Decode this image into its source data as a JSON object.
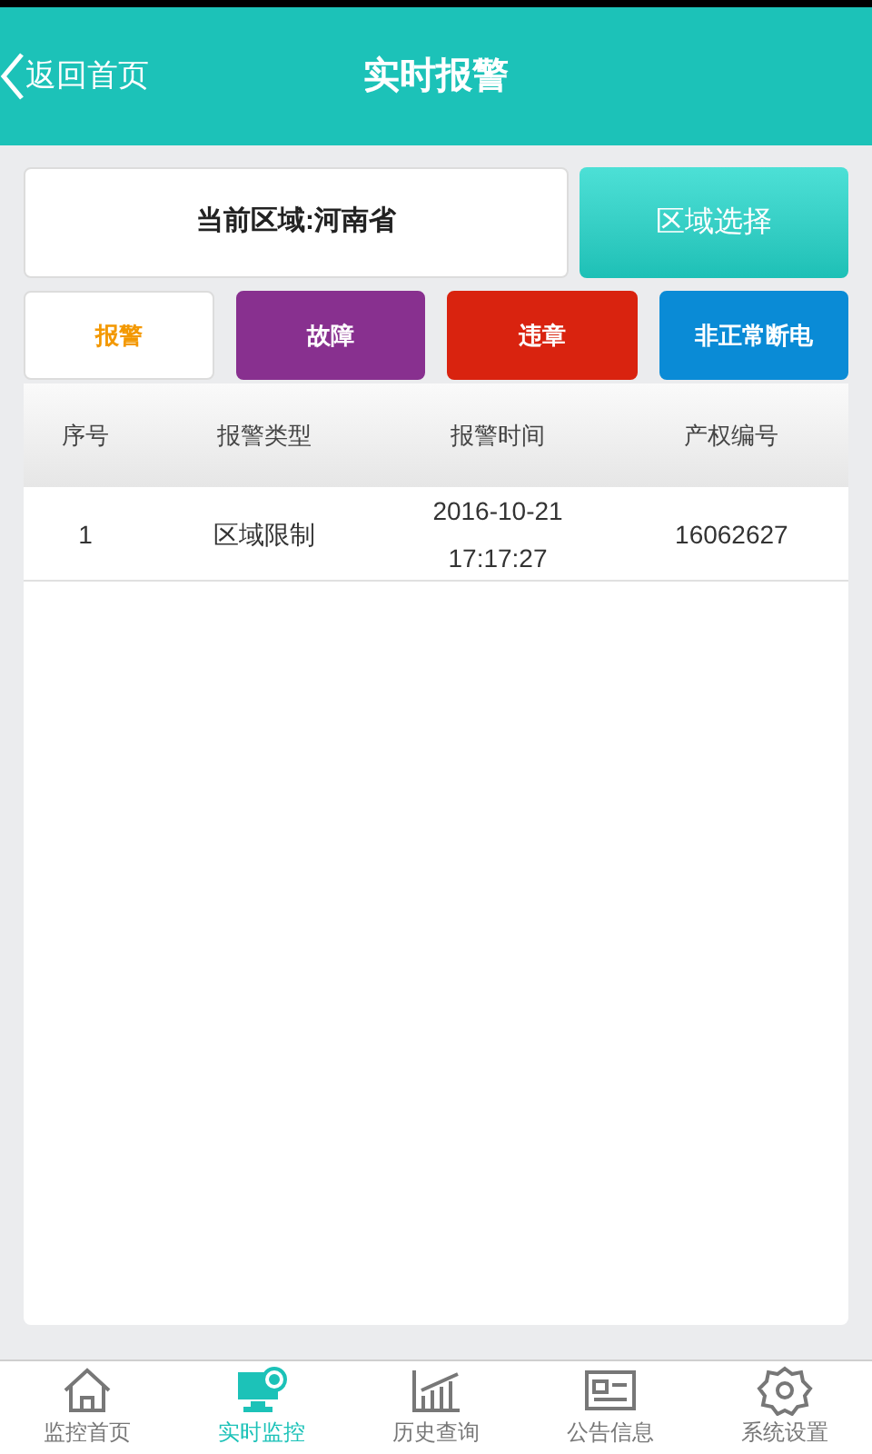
{
  "header": {
    "back": "返回首页",
    "title": "实时报警"
  },
  "region": {
    "label": "当前区域:河南省",
    "button": "区域选择"
  },
  "filters": [
    {
      "label": "报警",
      "color": "#f39800",
      "selected": true
    },
    {
      "label": "故障",
      "color": "#88308f",
      "selected": false
    },
    {
      "label": "违章",
      "color": "#d9230f",
      "selected": false
    },
    {
      "label": "非正常断电",
      "color": "#0a8bd6",
      "selected": false
    }
  ],
  "table": {
    "columns": [
      "序号",
      "报警类型",
      "报警时间",
      "产权编号"
    ],
    "rows": [
      [
        "1",
        "区域限制",
        "2016-10-21\n17:17:27",
        "16062627"
      ]
    ]
  },
  "nav": [
    {
      "kind": "home",
      "label": "监控首页",
      "selected": false
    },
    {
      "kind": "monitor",
      "label": "实时监控",
      "selected": true
    },
    {
      "kind": "chart",
      "label": "历史查询",
      "selected": false
    },
    {
      "kind": "notice",
      "label": "公告信息",
      "selected": false
    },
    {
      "kind": "settings",
      "label": "系统设置",
      "selected": false
    }
  ]
}
